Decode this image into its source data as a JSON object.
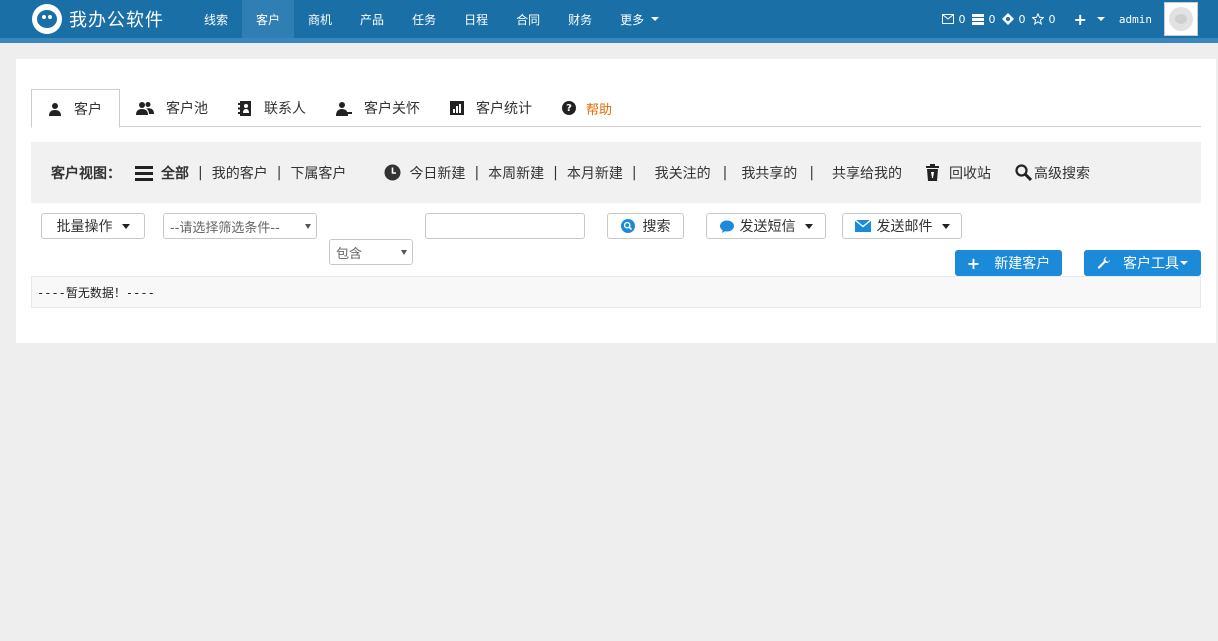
{
  "brand": {
    "name": "我办公软件",
    "logo_icon": "monkey-logo-icon"
  },
  "nav": {
    "items": [
      {
        "label": "线索",
        "active": false
      },
      {
        "label": "客户",
        "active": true
      },
      {
        "label": "商机",
        "active": false
      },
      {
        "label": "产品",
        "active": false
      },
      {
        "label": "任务",
        "active": false
      },
      {
        "label": "日程",
        "active": false
      },
      {
        "label": "合同",
        "active": false
      },
      {
        "label": "财务",
        "active": false
      },
      {
        "label": "更多",
        "active": false
      }
    ],
    "counters": [
      {
        "icon": "mail-icon",
        "count": "0"
      },
      {
        "icon": "inbox-icon",
        "count": "0"
      },
      {
        "icon": "crosshair-icon",
        "count": "0"
      },
      {
        "icon": "star-icon",
        "count": "0"
      }
    ],
    "add_label": "+",
    "user": "admin"
  },
  "tabs": [
    {
      "label": "客户",
      "icon": "user-icon",
      "active": true
    },
    {
      "label": "客户池",
      "icon": "users-icon",
      "active": false
    },
    {
      "label": "联系人",
      "icon": "address-book-icon",
      "active": false
    },
    {
      "label": "客户关怀",
      "icon": "user-care-icon",
      "active": false
    },
    {
      "label": "客户统计",
      "icon": "bar-chart-icon",
      "active": false
    },
    {
      "label": "帮助",
      "icon": "help-icon",
      "active": false
    }
  ],
  "view": {
    "label": "客户视图：",
    "all": "全部",
    "mine": "我的客户",
    "subordinate": "下属客户",
    "today_new": "今日新建",
    "week_new": "本周新建",
    "month_new": "本月新建",
    "followed": "我关注的",
    "shared_by_me": "我共享的",
    "shared_to_me": "共享给我的",
    "recycle": "回收站",
    "advanced_search": "高级搜索"
  },
  "filters": {
    "batch": "批量操作",
    "condition": "--请选择筛选条件--",
    "match": "包含",
    "keyword": "",
    "search": "搜索",
    "send_sms": "发送短信",
    "send_email": "发送邮件"
  },
  "actions": {
    "new_customer": "新建客户",
    "customer_tools": "客户工具"
  },
  "table": {
    "empty_text": "----暂无数据！----"
  }
}
